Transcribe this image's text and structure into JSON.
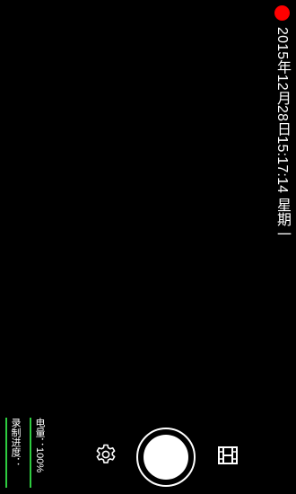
{
  "recording": {
    "indicator_color": "#ff0000",
    "timestamp": "2015年12月28日15:17:14 星期一"
  },
  "status": {
    "battery_label": "电量：100%",
    "progress_label": "录制进度：",
    "bar_color": "#2ecc40"
  },
  "controls": {
    "settings_icon": "gear-icon",
    "shutter": "shutter-button",
    "gallery_icon": "film-icon"
  }
}
